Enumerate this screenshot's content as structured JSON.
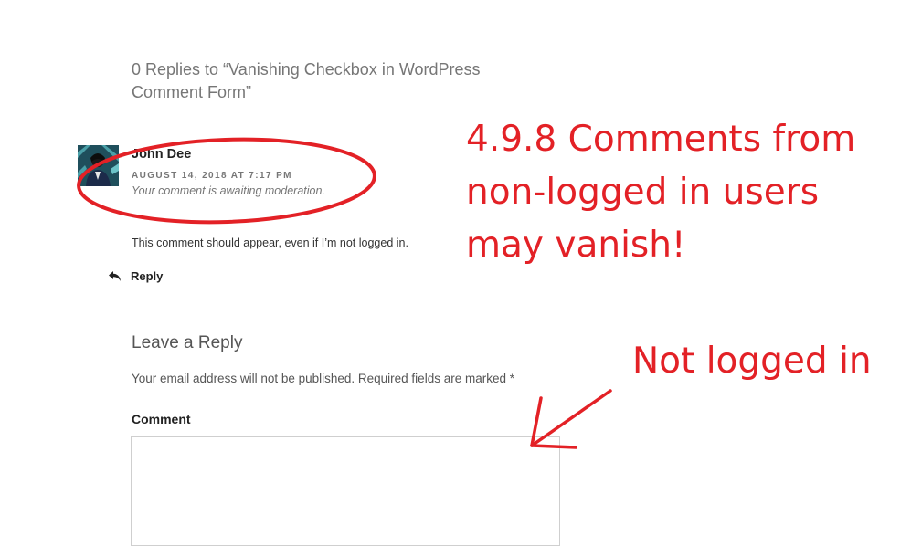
{
  "comments_area": {
    "title": "0 Replies to “Vanishing Checkbox in WordPress Comment Form”"
  },
  "comment": {
    "avatar_icon": "user-avatar-photo",
    "author": "John Dee",
    "date": "AUGUST 14, 2018 AT 7:17 PM",
    "moderation_notice": "Your comment is awaiting moderation.",
    "text": "This comment should appear, even if I’m not logged in.",
    "reply_icon": "reply-arrow-icon",
    "reply_label": "Reply"
  },
  "respond": {
    "title": "Leave a Reply",
    "notes": "Your email address will not be published. Required fields are marked *",
    "comment_label": "Comment",
    "comment_value": ""
  },
  "annotations": {
    "headline": "4.9.8 Comments from non-logged in users may vanish!",
    "side_note": "Not logged in",
    "color": "#e32126"
  }
}
